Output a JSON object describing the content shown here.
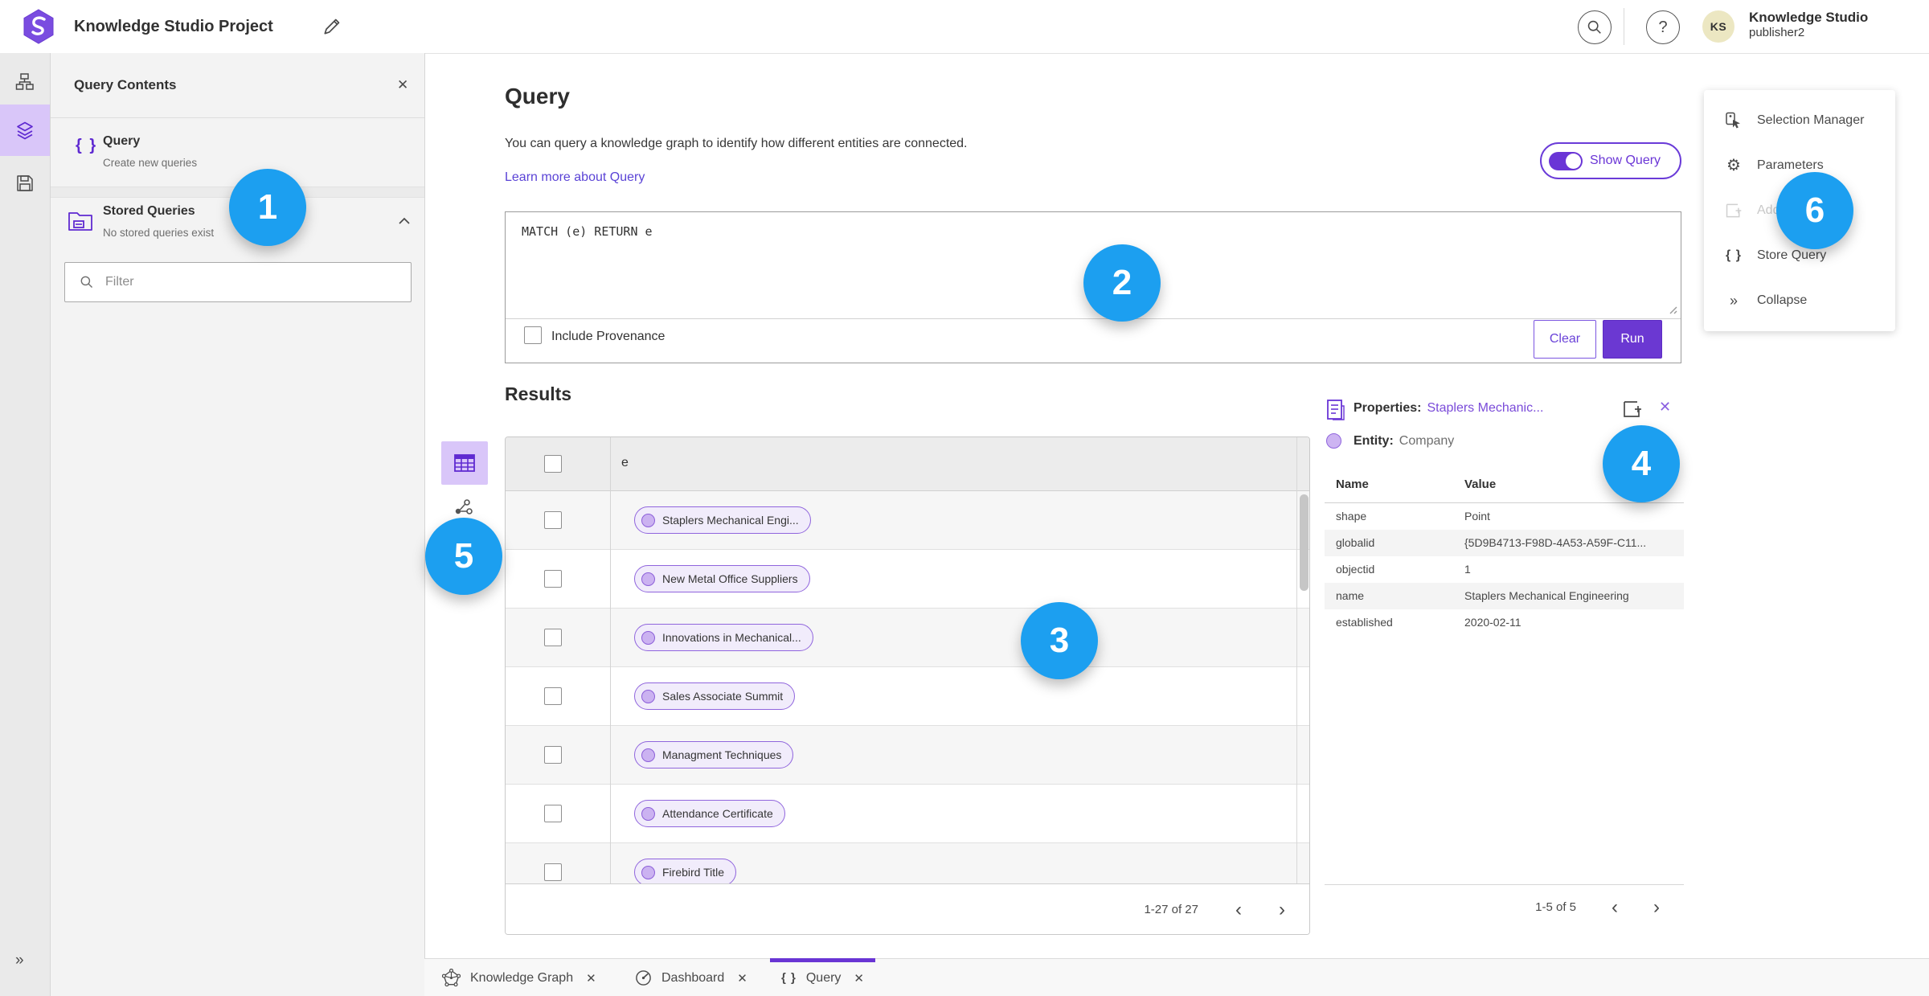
{
  "colors": {
    "accent_purple": "#6a3bd8",
    "icon_purple": "#5f2ad1",
    "annotation_blue": "#1c9ff0",
    "avatar_bg": "#ece7c2",
    "link_purple": "#5a43d6"
  },
  "icons": {
    "close": "✕",
    "help": "?",
    "braces": "{ }",
    "collapse_double": "»",
    "expand_double": "»",
    "gear": "⚙",
    "chevron_left": "‹",
    "chevron_right": "›"
  },
  "header": {
    "title": "Knowledge Studio Project",
    "user_name": "Knowledge Studio",
    "user_role": "publisher2",
    "avatar_initials": "KS"
  },
  "left_panel": {
    "title": "Query Contents",
    "query_item_label": "Query",
    "query_item_desc": "Create new queries",
    "stored_label": "Stored Queries",
    "stored_desc": "No stored queries exist",
    "filter_placeholder": "Filter"
  },
  "query_section": {
    "heading": "Query",
    "description": "You can query a knowledge graph to identify how different entities are connected.",
    "learn_link": "Learn more about Query",
    "show_query_label": "Show Query",
    "code": "MATCH (e) RETURN e",
    "include_provenance": "Include Provenance",
    "clear": "Clear",
    "run": "Run"
  },
  "results": {
    "heading": "Results",
    "column": "e",
    "rows": [
      "Staplers Mechanical Engi...",
      "New Metal Office Suppliers",
      "Innovations in Mechanical...",
      "Sales Associate Summit",
      "Managment Techniques",
      "Attendance Certificate",
      "Firebird Title"
    ],
    "pagination": "1-27 of 27"
  },
  "properties": {
    "label": "Properties:",
    "selected_name": "Staplers Mechanic...",
    "entity_label": "Entity:",
    "entity_type": "Company",
    "col_name": "Name",
    "col_value": "Value",
    "rows": [
      [
        "shape",
        "Point"
      ],
      [
        "globalid",
        "{5D9B4713-F98D-4A53-A59F-C11..."
      ],
      [
        "objectid",
        "1"
      ],
      [
        "name",
        "Staplers Mechanical Engineering"
      ],
      [
        "established",
        "2020-02-11"
      ]
    ],
    "pagination": "1-5 of 5"
  },
  "right_menu": {
    "items": [
      "Selection Manager",
      "Parameters",
      "Add",
      "Store Query",
      "Collapse"
    ]
  },
  "tabs": [
    {
      "label": "Knowledge Graph"
    },
    {
      "label": "Dashboard"
    },
    {
      "label": "Query"
    }
  ],
  "annotations": [
    "1",
    "2",
    "3",
    "4",
    "5",
    "6"
  ]
}
